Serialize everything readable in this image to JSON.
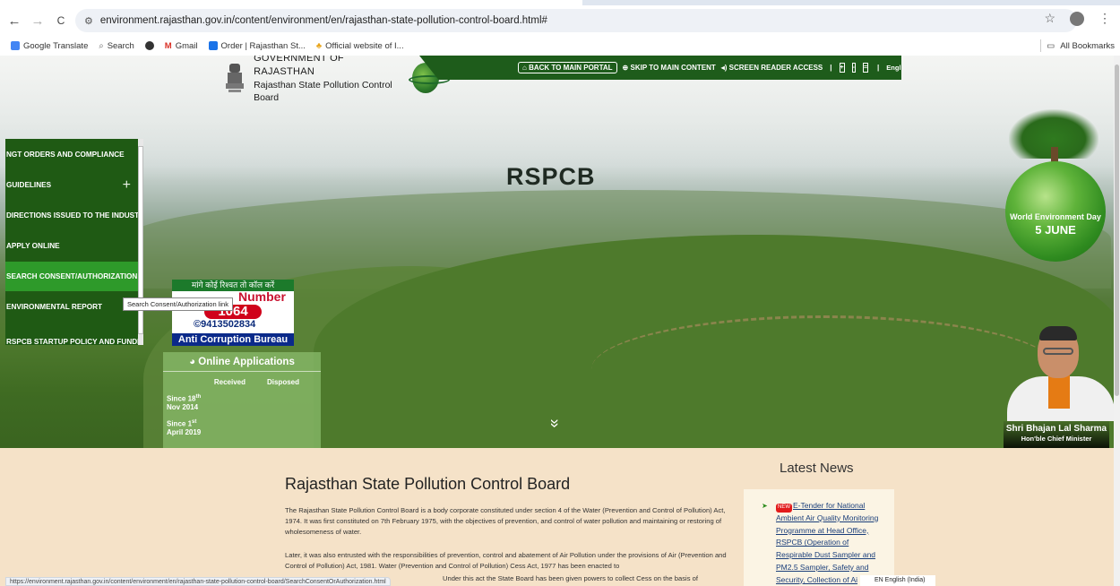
{
  "browser": {
    "url": "environment.rajasthan.gov.in/content/environment/en/rajasthan-state-pollution-control-board.html#",
    "back": "←",
    "forward": "→",
    "reload": "C",
    "bookmarks": [
      {
        "label": "Google Translate",
        "color": "#4285f4"
      },
      {
        "label": "Search",
        "color": "#888888"
      },
      {
        "label": "",
        "color": "#333333"
      },
      {
        "label": "Gmail",
        "color": "#d93025"
      },
      {
        "label": "Order | Rajasthan St...",
        "color": "#1a73e8"
      },
      {
        "label": "Official website of I...",
        "color": "#e8a317"
      }
    ],
    "all_bookmarks": "All Bookmarks",
    "status_url": "https://environment.rajasthan.gov.in/content/environment/en/rajasthan-state-pollution-control-board/SearchConsentOrAuthorization.html",
    "ime": "EN English (India)"
  },
  "header": {
    "gov_line1": "GOVERNMENT OF RAJASTHAN",
    "gov_line2": "Rajasthan State Pollution Control Board",
    "back_portal": "BACK TO MAIN PORTAL",
    "skip": "SKIP TO MAIN CONTENT",
    "reader": "SCREEN READER ACCESS",
    "font_plus": "+",
    "font_reset": "-",
    "font_minus": "=",
    "language": "English",
    "sep": "|"
  },
  "side_menu": {
    "items": [
      {
        "label": "NGT ORDERS AND COMPLIANCE",
        "plus": ""
      },
      {
        "label": "GUIDELINES",
        "plus": "+"
      },
      {
        "label": "DIRECTIONS ISSUED TO THE INDUSTRIES",
        "plus": ""
      },
      {
        "label": "APPLY ONLINE",
        "plus": ""
      },
      {
        "label": "SEARCH CONSENT/AUTHORIZATION",
        "plus": ""
      },
      {
        "label": "ENVIRONMENTAL REPORT",
        "plus": "+"
      },
      {
        "label": "RSPCB STARTUP POLICY AND FUNDING",
        "plus": ""
      }
    ],
    "tooltip": "Search Consent/Authorization link"
  },
  "acb": {
    "head": "मांगे कोई रिश्वत तो कॉल करें",
    "toll": "Number",
    "number": "1064",
    "phone": "©9413502834",
    "foot": "Anti Corruption Bureau"
  },
  "online_apps": {
    "title": "Online Applications",
    "col1": "Received",
    "col2": "Disposed",
    "row1_a": "Since 18",
    "row1_sup": "th",
    "row1_b": "Nov 2014",
    "row2_a": "Since 1",
    "row2_sup": "st",
    "row2_b": "April 2019"
  },
  "hero": {
    "title": "RSPCB",
    "chevron": "»",
    "wed_line": "World Environment Day",
    "wed_date": "5 JUNE",
    "cm_name": "Shri Bhajan Lal Sharma",
    "cm_role": "Hon'ble Chief Minister"
  },
  "main": {
    "title": "Rajasthan State Pollution Control Board",
    "para1": "The Rajasthan State Pollution Control Board is a body corporate constituted under section 4 of the Water (Prevention and Control of Pollution) Act, 1974. It was first constituted on 7th February 1975, with the objectives of prevention, and control of water pollution and maintaining or restoring of wholesomeness of water.",
    "para2": "Later, it was also entrusted with the responsibilities of prevention, control and abatement of Air Pollution under the provisions of Air (Prevention and Control of Pollution) Act, 1981. Water (Prevention and Control of Pollution) Cess Act, 1977 has been enacted to",
    "para3": "Under this act the State Board has been given powers to collect Cess on the basis of"
  },
  "news": {
    "title": "Latest News",
    "badge": "NEW",
    "item": "E-Tender for National Ambient Air Quality Monitoring Programme at Head Office, RSPCB (Operation of Respirable Dust Sampler and PM2.5 Sampler, Safety and Security, Collection of Ai"
  },
  "colors": {
    "brand_green": "#1e5c1b",
    "menu_active": "#2e9a2a",
    "content_bg": "#f5e2c8"
  }
}
